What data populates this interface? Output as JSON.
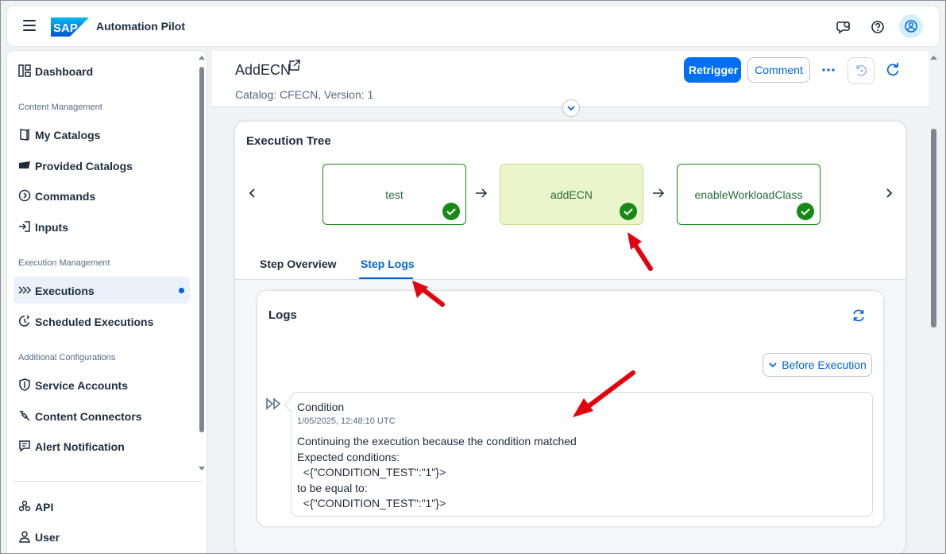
{
  "shell": {
    "brand": "SAP",
    "app_title": "Automation Pilot"
  },
  "sidebar": {
    "items": [
      {
        "label": "Dashboard"
      },
      {
        "group": "Content Management"
      },
      {
        "label": "My Catalogs"
      },
      {
        "label": "Provided Catalogs"
      },
      {
        "label": "Commands"
      },
      {
        "label": "Inputs"
      },
      {
        "group": "Execution Management"
      },
      {
        "label": "Executions"
      },
      {
        "label": "Scheduled Executions"
      },
      {
        "group": "Additional Configurations"
      },
      {
        "label": "Service Accounts"
      },
      {
        "label": "Content Connectors"
      },
      {
        "label": "Alert Notification"
      },
      {
        "label": "API"
      },
      {
        "label": "User"
      }
    ]
  },
  "header": {
    "title": "AddECN",
    "subtitle": "Catalog: CFECN, Version: 1",
    "retrigger": "Retrigger",
    "comment": "Comment"
  },
  "execution_tree": {
    "title": "Execution Tree",
    "nodes": [
      {
        "label": "test",
        "status": "success"
      },
      {
        "label": "addECN",
        "status": "success",
        "selected": true
      },
      {
        "label": "enableWorkloadClass",
        "status": "success"
      }
    ]
  },
  "tabs": [
    {
      "label": "Step Overview"
    },
    {
      "label": "Step Logs",
      "selected": true
    }
  ],
  "logs": {
    "title": "Logs",
    "filter_button": "Before Execution",
    "entry": {
      "name": "Condition",
      "timestamp": "1/05/2025, 12:48:10 UTC",
      "lines": "Continuing the execution because the condition matched\nExpected conditions:\n  <{\"CONDITION_TEST\":\"1\"}>\nto be equal to:\n  <{\"CONDITION_TEST\":\"1\"}>"
    }
  },
  "colors": {
    "brand_blue": "#0070f2",
    "success_green": "#188918",
    "selected_node": "#ebf5cb",
    "annotation_red": "#e3000f"
  }
}
